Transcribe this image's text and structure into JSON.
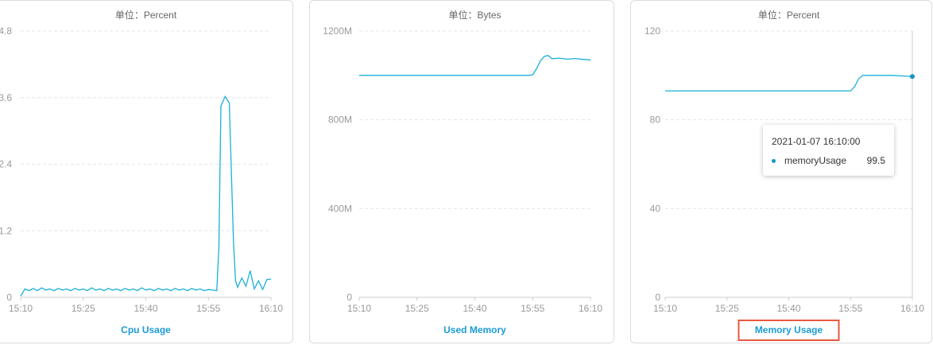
{
  "chart_data": [
    {
      "type": "line",
      "unit_label": "单位：Percent",
      "title": "Cpu Usage",
      "highlighted": false,
      "ylim": [
        0,
        4.8
      ],
      "y_ticks": [
        "0",
        "1.2",
        "2.4",
        "3.6",
        "4.8"
      ],
      "x_ticks": [
        "15:10",
        "15:25",
        "15:40",
        "15:55",
        "16:10"
      ],
      "series": [
        {
          "color": "#1ab0d8",
          "x": [
            0,
            1,
            2,
            3,
            4,
            5,
            6,
            7,
            8,
            9,
            10,
            11,
            12,
            13,
            14,
            15,
            16,
            17,
            18,
            19,
            20,
            21,
            22,
            23,
            24,
            25,
            26,
            27,
            28,
            29,
            30,
            31,
            32,
            33,
            34,
            35,
            36,
            37,
            38,
            39,
            40,
            41,
            42,
            43,
            44,
            45,
            46,
            47,
            47.5,
            48,
            49,
            50,
            51,
            51.5,
            52,
            53,
            54,
            55,
            56,
            57,
            58,
            59,
            60
          ],
          "values": [
            0.02,
            0.15,
            0.12,
            0.16,
            0.12,
            0.17,
            0.13,
            0.15,
            0.12,
            0.16,
            0.13,
            0.15,
            0.12,
            0.16,
            0.13,
            0.15,
            0.12,
            0.17,
            0.13,
            0.15,
            0.12,
            0.16,
            0.13,
            0.15,
            0.12,
            0.16,
            0.13,
            0.15,
            0.12,
            0.17,
            0.13,
            0.15,
            0.12,
            0.16,
            0.13,
            0.15,
            0.12,
            0.16,
            0.13,
            0.15,
            0.12,
            0.16,
            0.13,
            0.15,
            0.12,
            0.14,
            0.13,
            0.12,
            0.9,
            3.45,
            3.62,
            3.5,
            1.0,
            0.3,
            0.18,
            0.35,
            0.2,
            0.48,
            0.15,
            0.3,
            0.14,
            0.32,
            0.33
          ]
        }
      ]
    },
    {
      "type": "line",
      "unit_label": "单位：Bytes",
      "title": "Used Memory",
      "highlighted": false,
      "ylim": [
        0,
        1200
      ],
      "y_ticks": [
        "0",
        "400M",
        "800M",
        "1200M"
      ],
      "x_ticks": [
        "15:10",
        "15:25",
        "15:40",
        "15:55",
        "16:10"
      ],
      "series": [
        {
          "color": "#1ab0d8",
          "x": [
            0,
            5,
            10,
            15,
            20,
            25,
            30,
            35,
            40,
            44,
            45,
            46,
            47,
            48,
            49,
            50,
            52,
            54,
            56,
            58,
            60
          ],
          "values": [
            1000,
            1000,
            1000,
            1000,
            1000,
            1000,
            1000,
            1000,
            1000,
            1000,
            1003,
            1030,
            1065,
            1085,
            1090,
            1075,
            1078,
            1073,
            1076,
            1072,
            1070
          ]
        }
      ]
    },
    {
      "type": "line",
      "unit_label": "单位：Percent",
      "title": "Memory Usage",
      "highlighted": true,
      "ylim": [
        0,
        120
      ],
      "y_ticks": [
        "0",
        "40",
        "80",
        "120"
      ],
      "x_ticks": [
        "15:10",
        "15:25",
        "15:40",
        "15:55",
        "16:10"
      ],
      "series": [
        {
          "color": "#1ab0d8",
          "x": [
            0,
            10,
            20,
            30,
            40,
            45,
            46,
            47,
            48,
            50,
            55,
            60
          ],
          "values": [
            93,
            93,
            93,
            93,
            93,
            93,
            95,
            98.5,
            100,
            100,
            100,
            99.5
          ]
        }
      ],
      "tooltip": {
        "time": "2021-01-07 16:10:00",
        "series_name": "memoryUsage",
        "value": "99.5"
      }
    }
  ]
}
